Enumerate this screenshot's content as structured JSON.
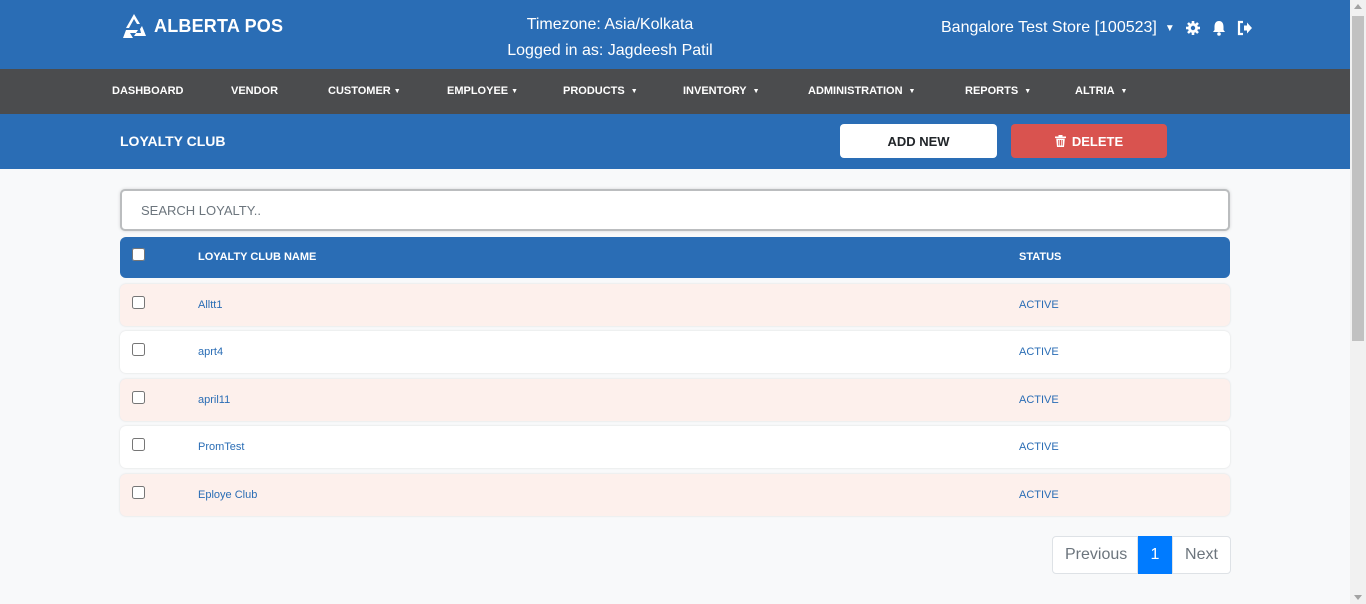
{
  "header": {
    "brand": "ALBERTA POS",
    "timezone": "Timezone: Asia/Kolkata",
    "logged_in": "Logged in as: Jagdeesh Patil",
    "store": "Bangalore Test Store [100523]"
  },
  "nav": {
    "items": [
      {
        "label": "DASHBOARD",
        "dropdown": false
      },
      {
        "label": "VENDOR",
        "dropdown": false
      },
      {
        "label": "CUSTOMER",
        "dropdown": true
      },
      {
        "label": "EMPLOYEE",
        "dropdown": true
      },
      {
        "label": "PRODUCTS",
        "dropdown": true
      },
      {
        "label": "INVENTORY",
        "dropdown": true
      },
      {
        "label": "ADMINISTRATION",
        "dropdown": true
      },
      {
        "label": "REPORTS",
        "dropdown": true
      },
      {
        "label": "ALTRIA",
        "dropdown": true
      }
    ]
  },
  "page": {
    "title": "LOYALTY CLUB",
    "add_label": "ADD NEW",
    "delete_label": "DELETE"
  },
  "search": {
    "placeholder": "SEARCH LOYALTY..",
    "value": ""
  },
  "table": {
    "columns": [
      "LOYALTY CLUB NAME",
      "STATUS"
    ],
    "rows": [
      {
        "name": "Alltt1",
        "status": "ACTIVE"
      },
      {
        "name": "aprt4",
        "status": "ACTIVE"
      },
      {
        "name": "april11",
        "status": "ACTIVE"
      },
      {
        "name": "PromTest",
        "status": "ACTIVE"
      },
      {
        "name": "Eploye Club",
        "status": "ACTIVE"
      }
    ]
  },
  "pagination": {
    "previous": "Previous",
    "current": "1",
    "next": "Next"
  },
  "colors": {
    "primary": "#2a6db5",
    "nav_bg": "#4b4c4e",
    "danger": "#d9534f",
    "row_tint": "#fdf0ec",
    "page_active": "#007bff"
  }
}
